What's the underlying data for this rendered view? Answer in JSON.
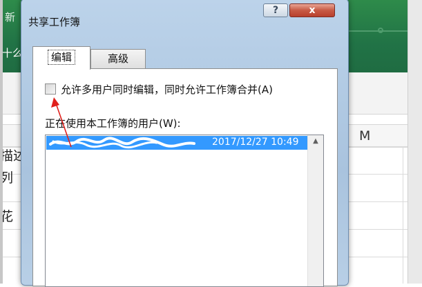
{
  "background": {
    "title_fragment": "新",
    "tell_fragment": "十么",
    "column_m": "M",
    "cell_texts": [
      "描述",
      "列",
      "花"
    ]
  },
  "dialog": {
    "title": "共享工作簿",
    "help_label": "?",
    "close_label": "x",
    "tabs": [
      {
        "label": "编辑",
        "active": true
      },
      {
        "label": "高级",
        "active": false
      }
    ],
    "allow_multi_user_label": "允许多用户同时编辑，同时允许工作簿合并(A)",
    "allow_multi_user_checked": false,
    "users_label": "正在使用本工作簿的用户(W):",
    "users": [
      {
        "text": "2017/12/27 10:49",
        "selected": true
      }
    ],
    "scroll_up_icon": "▲"
  },
  "colors": {
    "excel_green": "#217346",
    "selection_blue": "#3399ff",
    "close_red": "#c75a45",
    "annotation_red": "#e0201c"
  }
}
